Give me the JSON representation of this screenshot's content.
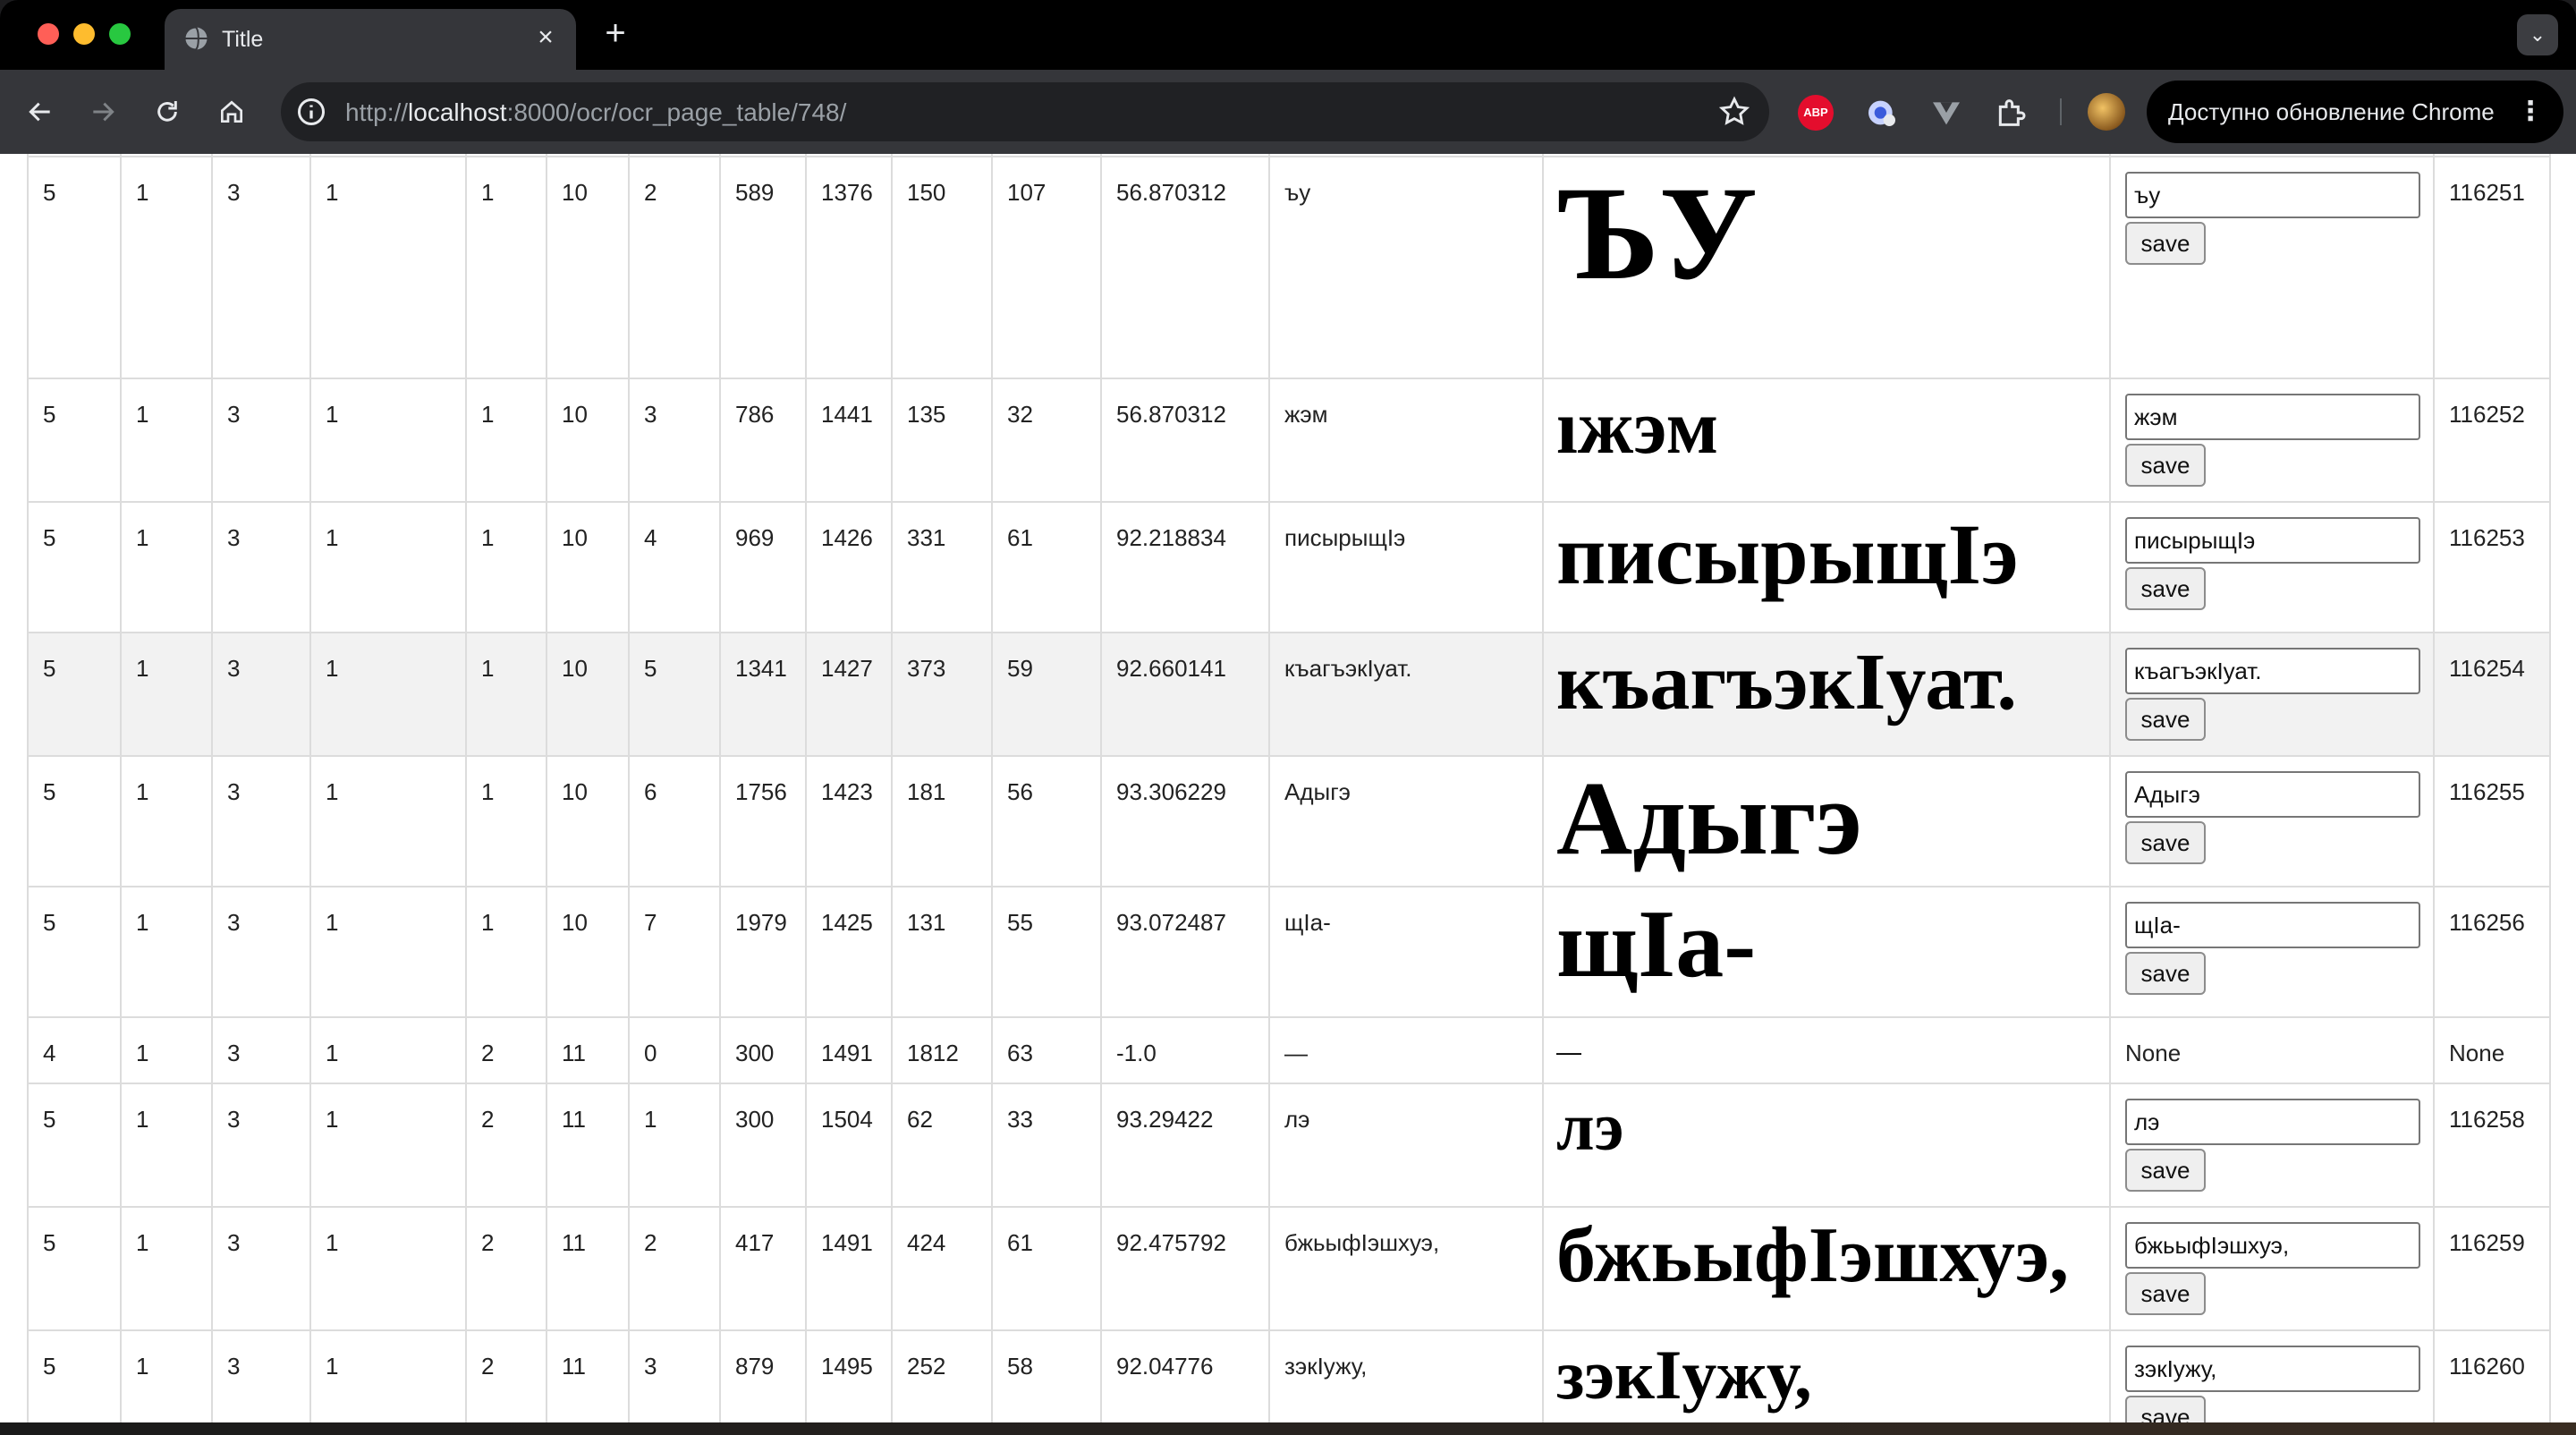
{
  "browser": {
    "tab_title": "Title",
    "url_prefix": "http://",
    "url_host": "localhost",
    "url_path": ":8000/ocr/ocr_page_table/748/",
    "abp_label": "ABP",
    "update_label": "Доступно обновление Chrome",
    "icons": {
      "new_tab": "+",
      "close": "×",
      "menu": "⋮",
      "tab_search": "⌄"
    }
  },
  "table": {
    "save_label": "save",
    "rows": [
      {
        "c": [
          "5",
          "1",
          "3",
          "1",
          "1",
          "10",
          "2",
          "589",
          "1376",
          "150",
          "107",
          "56.870312",
          "ъу"
        ],
        "crop": "ЪУ",
        "input": "ъу",
        "id": "116251"
      },
      {
        "c": [
          "5",
          "1",
          "3",
          "1",
          "1",
          "10",
          "3",
          "786",
          "1441",
          "135",
          "32",
          "56.870312",
          "жэм"
        ],
        "crop": "ıжэм",
        "input": "жэм",
        "id": "116252"
      },
      {
        "c": [
          "5",
          "1",
          "3",
          "1",
          "1",
          "10",
          "4",
          "969",
          "1426",
          "331",
          "61",
          "92.218834",
          "писырыщІэ"
        ],
        "crop": "писырыщІэ",
        "input": "писырыщІэ",
        "id": "116253"
      },
      {
        "c": [
          "5",
          "1",
          "3",
          "1",
          "1",
          "10",
          "5",
          "1341",
          "1427",
          "373",
          "59",
          "92.660141",
          "къагъэкIуат."
        ],
        "crop": "къагъэкIуат.",
        "input": "къагъэкIуат.",
        "id": "116254"
      },
      {
        "c": [
          "5",
          "1",
          "3",
          "1",
          "1",
          "10",
          "6",
          "1756",
          "1423",
          "181",
          "56",
          "93.306229",
          "Адыгэ"
        ],
        "crop": "Адыгэ",
        "input": "Адыгэ",
        "id": "116255"
      },
      {
        "c": [
          "5",
          "1",
          "3",
          "1",
          "1",
          "10",
          "7",
          "1979",
          "1425",
          "131",
          "55",
          "93.072487",
          "щIа-"
        ],
        "crop": "щIа-",
        "input": "щIа-",
        "id": "116256"
      },
      {
        "c": [
          "4",
          "1",
          "3",
          "1",
          "2",
          "11",
          "0",
          "300",
          "1491",
          "1812",
          "63",
          "-1.0",
          "—"
        ],
        "crop": "—",
        "input": "None",
        "id": "None"
      },
      {
        "c": [
          "5",
          "1",
          "3",
          "1",
          "2",
          "11",
          "1",
          "300",
          "1504",
          "62",
          "33",
          "93.29422",
          "лэ"
        ],
        "crop": "лэ",
        "input": "лэ",
        "id": "116258"
      },
      {
        "c": [
          "5",
          "1",
          "3",
          "1",
          "2",
          "11",
          "2",
          "417",
          "1491",
          "424",
          "61",
          "92.475792",
          "бжьыфIэшхуэ,"
        ],
        "crop": "бжьыфIэшхуэ,",
        "input": "бжьыфIэшхуэ,",
        "id": "116259"
      },
      {
        "c": [
          "5",
          "1",
          "3",
          "1",
          "2",
          "11",
          "3",
          "879",
          "1495",
          "252",
          "58",
          "92.04776",
          "зэкIужу,"
        ],
        "crop": "зэкIужу,",
        "input": "зэкIужу,",
        "id": "116260"
      }
    ]
  }
}
